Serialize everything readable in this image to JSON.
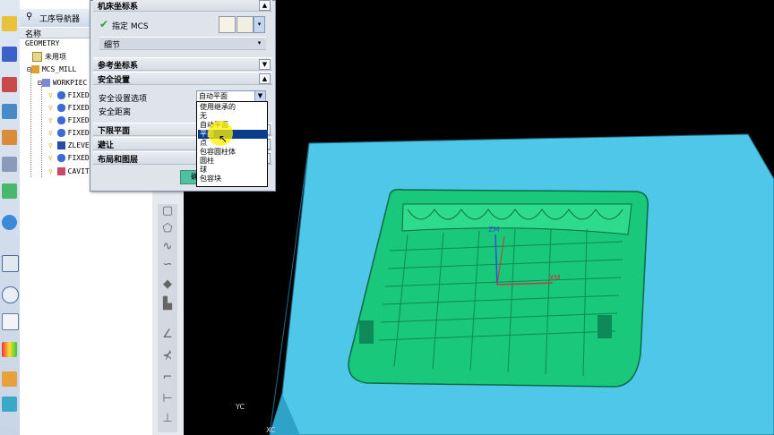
{
  "navigator": {
    "title": "工序导航器",
    "column_header": "名称",
    "items": [
      {
        "label": "GEOMETRY"
      },
      {
        "label": "未用项"
      },
      {
        "label": "MCS_MILL"
      },
      {
        "label": "WORKPIEC"
      },
      {
        "label": "FIXED"
      },
      {
        "label": "FIXED"
      },
      {
        "label": "FIXED"
      },
      {
        "label": "FIXED"
      },
      {
        "label": "ZLEVE"
      },
      {
        "label": "FIXED"
      },
      {
        "label": "CAVIT"
      }
    ]
  },
  "dialog": {
    "section_mcs": "机床坐标系",
    "specify_mcs": "指定 MCS",
    "details": "细节",
    "section_ref": "参考坐标系",
    "section_safety": "安全设置",
    "safety_option_label": "安全设置选项",
    "safety_option_value": "自动平面",
    "safety_distance_label": "安全距离",
    "section_lower": "下限平面",
    "section_avoid": "避让",
    "section_layout": "布局和图层",
    "ok_label": "确"
  },
  "dropdown": {
    "options": [
      {
        "label": "使用继承的",
        "selected": false
      },
      {
        "label": "无",
        "selected": false
      },
      {
        "label": "自动平面",
        "selected": false
      },
      {
        "label": "平面",
        "selected": true
      },
      {
        "label": "点",
        "selected": false
      },
      {
        "label": "包容圆柱体",
        "selected": false
      },
      {
        "label": "圆柱",
        "selected": false
      },
      {
        "label": "球",
        "selected": false
      },
      {
        "label": "包容块",
        "selected": false
      }
    ]
  },
  "viewport": {
    "axis_zm": "ZM",
    "axis_xm": "XM",
    "axis_yc": "YC",
    "axis_xc": "XC"
  },
  "colors": {
    "plate": "#4fc7e8",
    "part": "#19c87a",
    "selection": "#0a3d8c"
  }
}
